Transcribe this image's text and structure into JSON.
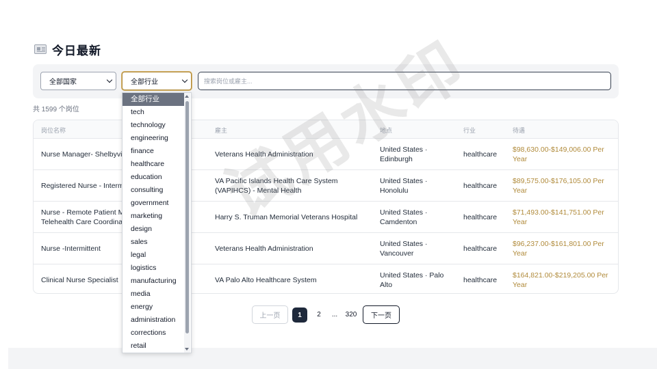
{
  "header": {
    "title": "今日最新",
    "icon": "newspaper-icon"
  },
  "filters": {
    "country_selected": "全部国家",
    "industry_selected": "全部行业",
    "search_placeholder": "搜索岗位或雇主..."
  },
  "summary": {
    "count_text": "共 1599 个岗位"
  },
  "table": {
    "columns": {
      "title": "岗位名称",
      "employer": "雇主",
      "location": "地点",
      "industry": "行业",
      "salary": "待遇"
    },
    "rows": [
      {
        "title": "Nurse Manager- Shelbyville",
        "employer": "Veterans Health Administration",
        "location": "United States · Edinburgh",
        "industry": "healthcare",
        "salary": "$98,630.00-$149,006.00 Per Year"
      },
      {
        "title": "Registered Nurse - Intermittent",
        "employer": "VA Pacific Islands Health Care System (VAPIHCS) - Mental Health",
        "location": "United States · Honolulu",
        "industry": "healthcare",
        "salary": "$89,575.00-$176,105.00 Per Year"
      },
      {
        "title": "Nurse - Remote Patient Monitoring Telehealth Care Coordinator",
        "employer": "Harry S. Truman Memorial Veterans Hospital",
        "location": "United States · Camdenton",
        "industry": "healthcare",
        "salary": "$71,493.00-$141,751.00 Per Year"
      },
      {
        "title": "Nurse -Intermittent",
        "employer": "Veterans Health Administration",
        "location": "United States · Vancouver",
        "industry": "healthcare",
        "salary": "$96,237.00-$161,801.00 Per Year"
      },
      {
        "title": "Clinical Nurse Specialist",
        "employer": "VA Palo Alto Healthcare System",
        "location": "United States · Palo Alto",
        "industry": "healthcare",
        "salary": "$164,821.00-$219,205.00 Per Year"
      }
    ]
  },
  "pagination": {
    "prev": "上一页",
    "current": "1",
    "page2": "2",
    "ellipsis": "...",
    "last": "320",
    "next": "下一页"
  },
  "industry_dropdown": {
    "options": [
      "全部行业",
      "tech",
      "technology",
      "engineering",
      "finance",
      "healthcare",
      "education",
      "consulting",
      "government",
      "marketing",
      "design",
      "sales",
      "legal",
      "logistics",
      "manufacturing",
      "media",
      "energy",
      "administration",
      "corrections",
      "retail"
    ]
  },
  "watermark": {
    "text": "试用水印"
  },
  "colors": {
    "accent": "#b08a3a",
    "active_page": "#1e293b",
    "filter_bg": "#f3f4f6"
  }
}
